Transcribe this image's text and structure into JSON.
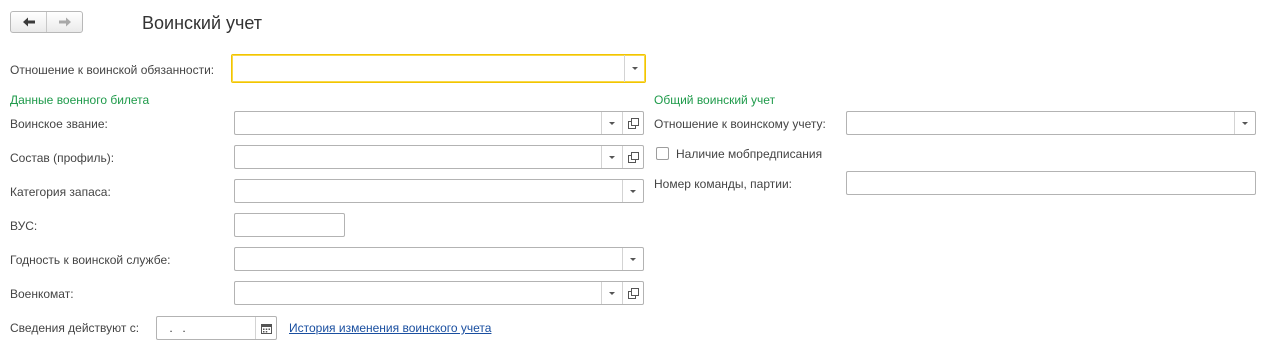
{
  "header": {
    "title": "Воинский учет",
    "back_icon": "arrow-left-icon",
    "forward_icon": "arrow-right-icon"
  },
  "attitude": {
    "label": "Отношение к воинской обязанности:",
    "value": ""
  },
  "military_id": {
    "section_title": "Данные военного билета",
    "rank_label": "Воинское звание:",
    "composition_label": "Состав (профиль):",
    "reserve_category_label": "Категория запаса:",
    "vus_label": "ВУС:",
    "fitness_label": "Годность к воинской службе:",
    "commissariat_label": "Военкомат:",
    "valid_from_label": "Сведения действуют с:",
    "valid_from_value": " .  .",
    "history_link": "История изменения воинского учета"
  },
  "general_registration": {
    "section_title": "Общий воинский учет",
    "attitude_label": "Отношение к воинскому учету:",
    "mob_order_label": "Наличие мобпредписания",
    "mob_order_checked": false,
    "team_number_label": "Номер команды, партии:"
  },
  "colors": {
    "section": "#1e9a4a",
    "focus_border": "#f2c500",
    "link": "#1a4fa0"
  }
}
